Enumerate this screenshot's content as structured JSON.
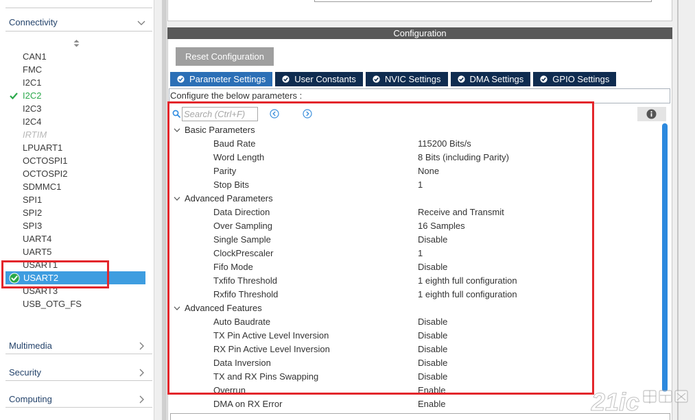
{
  "sidebar": {
    "category": "Connectivity",
    "items": [
      {
        "label": "CAN1"
      },
      {
        "label": "FMC"
      },
      {
        "label": "I2C1"
      },
      {
        "label": "I2C2",
        "configured": true
      },
      {
        "label": "I2C3"
      },
      {
        "label": "I2C4"
      },
      {
        "label": "IRTIM",
        "available": false
      },
      {
        "label": "LPUART1"
      },
      {
        "label": "OCTOSPI1"
      },
      {
        "label": "OCTOSPI2"
      },
      {
        "label": "SDMMC1"
      },
      {
        "label": "SPI1"
      },
      {
        "label": "SPI2"
      },
      {
        "label": "SPI3"
      },
      {
        "label": "UART4"
      },
      {
        "label": "UART5"
      },
      {
        "label": "USART1"
      },
      {
        "label": "USART2",
        "configured": true,
        "selected": true
      },
      {
        "label": "USART3"
      },
      {
        "label": "USB_OTG_FS"
      }
    ],
    "other_categories": [
      {
        "label": "Multimedia"
      },
      {
        "label": "Security"
      },
      {
        "label": "Computing"
      }
    ]
  },
  "configuration": {
    "header": "Configuration",
    "reset_label": "Reset Configuration",
    "tabs": [
      {
        "label": "Parameter Settings",
        "active": true
      },
      {
        "label": "User Constants"
      },
      {
        "label": "NVIC Settings"
      },
      {
        "label": "DMA Settings"
      },
      {
        "label": "GPIO Settings"
      }
    ],
    "hint": "Configure the below parameters :",
    "search_placeholder": "Search (Ctrl+F)",
    "groups": [
      {
        "label": "Basic Parameters",
        "expanded": true,
        "params": [
          {
            "name": "Baud Rate",
            "value": "115200 Bits/s"
          },
          {
            "name": "Word Length",
            "value": "8 Bits (including Parity)"
          },
          {
            "name": "Parity",
            "value": "None"
          },
          {
            "name": "Stop Bits",
            "value": "1"
          }
        ]
      },
      {
        "label": "Advanced Parameters",
        "expanded": true,
        "params": [
          {
            "name": "Data Direction",
            "value": "Receive and Transmit"
          },
          {
            "name": "Over Sampling",
            "value": "16 Samples"
          },
          {
            "name": "Single Sample",
            "value": "Disable"
          },
          {
            "name": "ClockPrescaler",
            "value": "1"
          },
          {
            "name": "Fifo Mode",
            "value": "Disable"
          },
          {
            "name": "Txfifo Threshold",
            "value": "1 eighth full configuration"
          },
          {
            "name": "Rxfifo Threshold",
            "value": "1 eighth full configuration"
          }
        ]
      },
      {
        "label": "Advanced Features",
        "expanded": true,
        "params": [
          {
            "name": "Auto Baudrate",
            "value": "Disable"
          },
          {
            "name": "TX Pin Active Level Inversion",
            "value": "Disable"
          },
          {
            "name": "RX Pin Active Level Inversion",
            "value": "Disable"
          },
          {
            "name": "Data Inversion",
            "value": "Disable"
          },
          {
            "name": "TX and RX Pins Swapping",
            "value": "Disable"
          },
          {
            "name": "Overrun",
            "value": "Enable"
          },
          {
            "name": "DMA on RX Error",
            "value": "Enable"
          }
        ]
      }
    ]
  },
  "icons": {
    "sort": "sort-icon",
    "category_open": "chevron-down-icon",
    "category_closed": "chevron-right-icon",
    "configured": "check-icon",
    "selected_configured": "check-circle-icon",
    "search": "search-icon",
    "previous": "chevron-left-circle-icon",
    "next": "chevron-right-circle-icon",
    "info": "info-icon"
  },
  "colors": {
    "selected_row": "#3e9de0",
    "configured_green": "#2aa84a",
    "category_title": "#24436b",
    "header_bar": "#595959",
    "tab_active": "#2b6fb6",
    "tab_inactive": "#0f2c50",
    "scrollbar": "#2c89de",
    "annotation_red": "#e3262b"
  },
  "watermark": {
    "brand": "21ic",
    "suffix": "电子网"
  }
}
